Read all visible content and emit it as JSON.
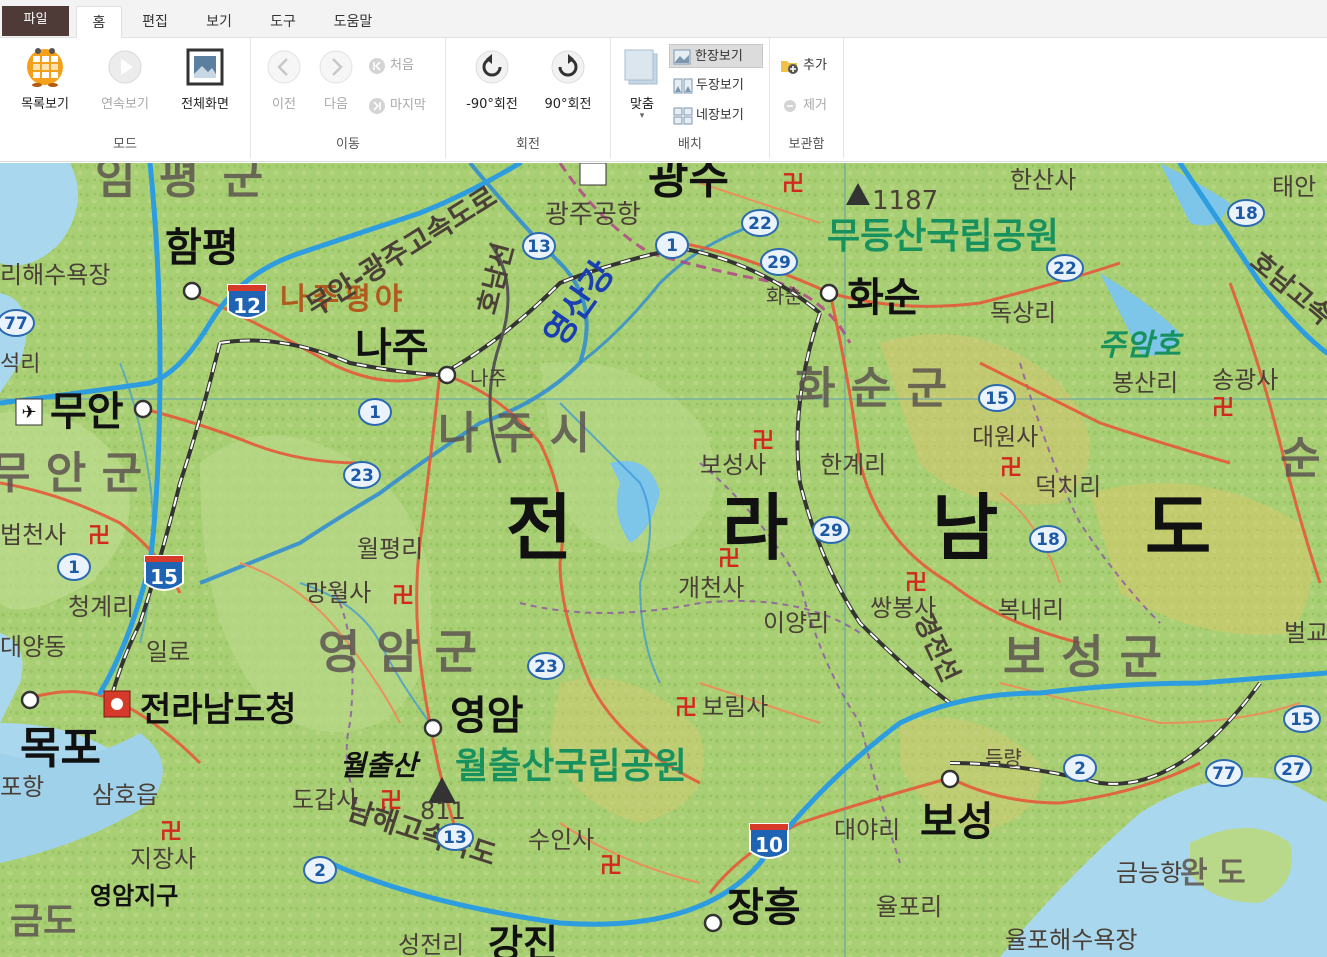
{
  "tabs": [
    {
      "label": "파일"
    },
    {
      "label": "홈"
    },
    {
      "label": "편집"
    },
    {
      "label": "보기"
    },
    {
      "label": "도구"
    },
    {
      "label": "도움말"
    }
  ],
  "ribbon": {
    "mode": {
      "label": "모드",
      "list_view": "목록보기",
      "continuous_view": "연속보기",
      "full_screen": "전체화면"
    },
    "move": {
      "label": "이동",
      "prev": "이전",
      "next": "다음",
      "first": "처음",
      "last": "마지막"
    },
    "rotate": {
      "label": "회전",
      "ccw": "-90°회전",
      "cw": "90°회전"
    },
    "layout": {
      "label": "배치",
      "fit": "맞춤",
      "single": "한장보기",
      "double": "두장보기",
      "quad": "네장보기"
    },
    "storage": {
      "label": "보관함",
      "add": "추가",
      "remove": "제거"
    }
  },
  "map": {
    "province": [
      "전",
      "라",
      "남",
      "도"
    ],
    "counties": [
      {
        "name": "임 평 군"
      },
      {
        "name": "무 안 군"
      },
      {
        "name": "나 주 시"
      },
      {
        "name": "화 순 군"
      },
      {
        "name": "영 암 군"
      },
      {
        "name": "보 성 군"
      },
      {
        "name": "순"
      },
      {
        "name": "완 도"
      }
    ],
    "towns": [
      {
        "name": "함평"
      },
      {
        "name": "나주"
      },
      {
        "name": "무안"
      },
      {
        "name": "화순"
      },
      {
        "name": "광주"
      },
      {
        "name": "목포"
      },
      {
        "name": "영암"
      },
      {
        "name": "보성"
      },
      {
        "name": "장흥"
      },
      {
        "name": "강진"
      }
    ],
    "places": [
      {
        "name": "광주공항"
      },
      {
        "name": "전라남도청"
      },
      {
        "name": "보성사"
      },
      {
        "name": "한계리"
      },
      {
        "name": "대원사"
      },
      {
        "name": "덕치리"
      },
      {
        "name": "개천사"
      },
      {
        "name": "쌍봉사"
      },
      {
        "name": "이양리"
      },
      {
        "name": "복내리"
      },
      {
        "name": "월평리"
      },
      {
        "name": "망월사"
      },
      {
        "name": "청계리"
      },
      {
        "name": "일로"
      },
      {
        "name": "대양동"
      },
      {
        "name": "법천사"
      },
      {
        "name": "보림사"
      },
      {
        "name": "수인사"
      },
      {
        "name": "도갑사"
      },
      {
        "name": "지장사"
      },
      {
        "name": "영암지구"
      },
      {
        "name": "삼호읍"
      },
      {
        "name": "포항"
      },
      {
        "name": "대야리"
      },
      {
        "name": "율포리"
      },
      {
        "name": "율포해수욕장"
      },
      {
        "name": "금능항"
      },
      {
        "name": "독상리"
      },
      {
        "name": "봉산리"
      },
      {
        "name": "송광사"
      },
      {
        "name": "한산사"
      },
      {
        "name": "태안"
      },
      {
        "name": "벌교"
      },
      {
        "name": "득량"
      },
      {
        "name": "성전리"
      },
      {
        "name": "화순"
      },
      {
        "name": "나주"
      },
      {
        "name": "리해수욕장"
      },
      {
        "name": "석리"
      },
      {
        "name": "금도"
      }
    ],
    "parks": [
      {
        "name": "무등산국립공원"
      },
      {
        "name": "월출산국립공원"
      }
    ],
    "mountains": [
      {
        "name": "월출산",
        "elevation": "811"
      },
      {
        "name": "",
        "elevation": "1187"
      }
    ],
    "waters": [
      {
        "name": "영산강"
      },
      {
        "name": "주암호"
      }
    ],
    "plains": "나주평야",
    "expressways": [
      {
        "name": "무안-광주고속도로"
      },
      {
        "name": "호남선"
      },
      {
        "name": "남해고속국도"
      },
      {
        "name": "경전선"
      },
      {
        "name": "호남고속"
      }
    ],
    "highway_shields": [
      "12",
      "15",
      "10"
    ],
    "route_numbers": [
      "1",
      "13",
      "22",
      "29",
      "23",
      "15",
      "18",
      "22",
      "18",
      "2",
      "13",
      "2",
      "77",
      "27",
      "15",
      "1",
      "77"
    ]
  }
}
